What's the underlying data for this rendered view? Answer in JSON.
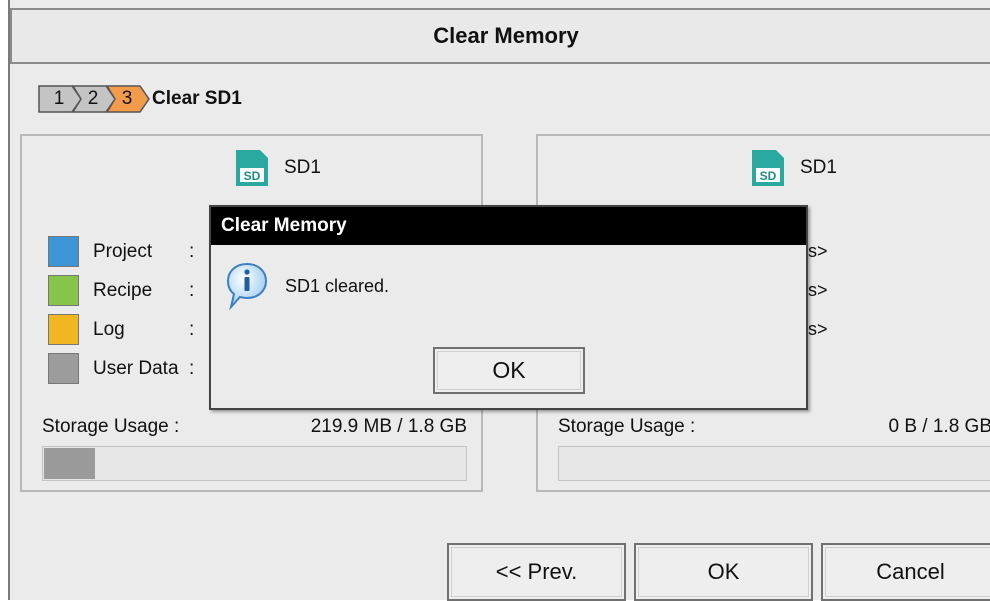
{
  "window": {
    "title": "Clear Memory"
  },
  "steps": {
    "items": [
      {
        "label": "1",
        "color": "#c4c4c4"
      },
      {
        "label": "2",
        "color": "#c4c4c4"
      },
      {
        "label": "3",
        "color": "#f29b4b"
      }
    ],
    "current_title": "Clear SD1"
  },
  "left_panel": {
    "device_label": "SD1",
    "device_icon": "sd-card-icon",
    "legend": [
      {
        "label": "Project",
        "colon": ":",
        "color": "#3d95d6"
      },
      {
        "label": "Recipe",
        "colon": ":",
        "color": "#86c44a"
      },
      {
        "label": "Log",
        "colon": ":",
        "color": "#f0b722"
      },
      {
        "label": "User Data",
        "colon": ":",
        "color": "#9c9c9c"
      }
    ],
    "usage_label": "Storage Usage :",
    "usage_value": "219.9 MB / 1.8 GB",
    "usage_fraction": 0.12
  },
  "right_panel": {
    "device_label": "SD1",
    "device_icon": "sd-card-icon",
    "legend_fragments": [
      "s>",
      "s>",
      "s>"
    ],
    "usage_label": "Storage Usage :",
    "usage_value": "0 B / 1.8 GB",
    "usage_fraction": 0
  },
  "buttons": {
    "prev": "<< Prev.",
    "ok": "OK",
    "cancel": "Cancel"
  },
  "dialog": {
    "title": "Clear Memory",
    "icon": "info-icon",
    "message": "SD1 cleared.",
    "ok": "OK"
  }
}
